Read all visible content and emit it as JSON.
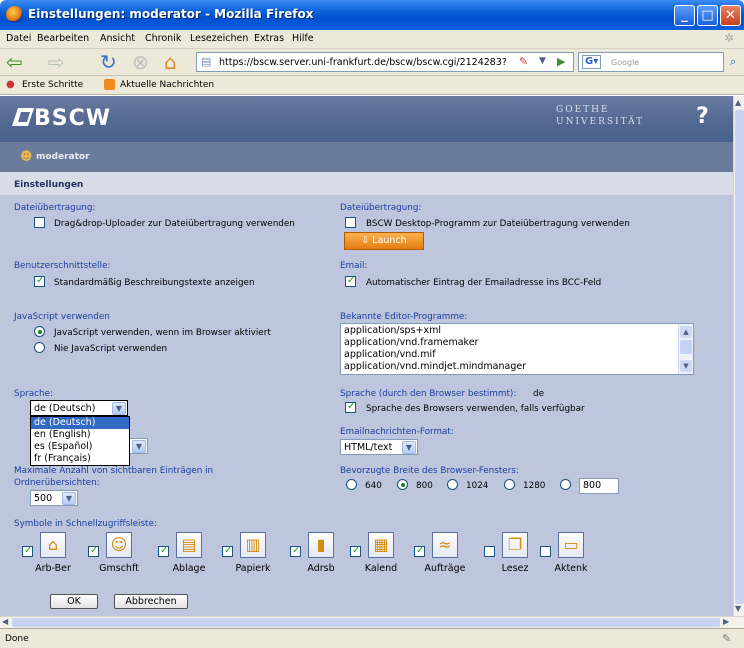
{
  "window": {
    "title": "Einstellungen: moderator - Mozilla Firefox",
    "min": "_",
    "max": "□",
    "close": "✕"
  },
  "menu": [
    "Datei",
    "Bearbeiten",
    "Ansicht",
    "Chronik",
    "Lesezeichen",
    "Extras",
    "Hilfe"
  ],
  "nav": {
    "url": "https://bscw.server.uni-frankfurt.de/bscw/bscw.cgi/2124283?",
    "search_placeholder": "Google"
  },
  "bookmarks": [
    "Erste Schritte",
    "Aktuelle Nachrichten"
  ],
  "banner": {
    "logo": "BSCW",
    "uni_line1": "GOETHE",
    "uni_line2": "UNIVERSITÄT",
    "help": "?"
  },
  "user": "moderator",
  "section_title": "Einstellungen",
  "left": {
    "upload_label": "Dateiübertragung:",
    "upload_option": "Drag&drop-Uploader zur Dateiübertragung verwenden",
    "ui_label": "Benutzerschnittstelle:",
    "ui_option": "Standardmäßig Beschreibungstexte anzeigen",
    "js_label": "JavaScript verwenden",
    "js_on": "JavaScript verwenden, wenn im Browser aktiviert",
    "js_off": "Nie JavaScript verwenden",
    "lang_label": "Sprache:",
    "lang_selected": "de (Deutsch)",
    "lang_options": [
      "de (Deutsch)",
      "en (English)",
      "es (Español)",
      "fr (Français)"
    ],
    "max_label_1": "Maximale Anzahl von sichtbaren Einträgen in",
    "max_label_2": "Ordnerübersichten:",
    "max_value": "500"
  },
  "right": {
    "upload_label": "Dateiübertragung:",
    "upload_option": "BSCW Desktop-Programm zur Dateiübertragung verwenden",
    "launch": "Launch",
    "email_label": "Email:",
    "email_option": "Automatischer Eintrag der Emailadresse ins BCC-Feld",
    "editor_label": "Bekannte Editor-Programme:",
    "editors": [
      "application/sps+xml",
      "application/vnd.framemaker",
      "application/vnd.mif",
      "application/vnd.mindjet.mindmanager"
    ],
    "browser_lang_label": "Sprache (durch den Browser bestimmt):",
    "browser_lang_value": "de",
    "browser_lang_option": "Sprache des Browsers verwenden, falls verfügbar",
    "mail_format_label": "Emailnachrichten-Format:",
    "mail_format_value": "HTML/text",
    "width_label": "Bevorzugte Breite des Browser-Fensters:",
    "widths": [
      "640",
      "800",
      "1024",
      "1280"
    ],
    "width_custom": "800"
  },
  "symbols_label": "Symbole in Schnellzugriffsleiste:",
  "symbols": [
    {
      "label": "Arb-Ber",
      "icon": "house-icon",
      "checked": true
    },
    {
      "label": "Gmschft",
      "icon": "community-icon",
      "checked": true
    },
    {
      "label": "Ablage",
      "icon": "clipboard-icon",
      "checked": true
    },
    {
      "label": "Papierk",
      "icon": "trash-icon",
      "checked": true
    },
    {
      "label": "Adrsb",
      "icon": "addressbook-icon",
      "checked": true
    },
    {
      "label": "Kalend",
      "icon": "calendar-icon",
      "checked": true
    },
    {
      "label": "Aufträge",
      "icon": "tasks-icon",
      "checked": true
    },
    {
      "label": "Lesez",
      "icon": "bookmark-icon",
      "checked": false
    },
    {
      "label": "Aktenk",
      "icon": "briefcase-icon",
      "checked": false
    }
  ],
  "buttons": {
    "ok": "OK",
    "cancel": "Abbrechen"
  },
  "status": "Done"
}
